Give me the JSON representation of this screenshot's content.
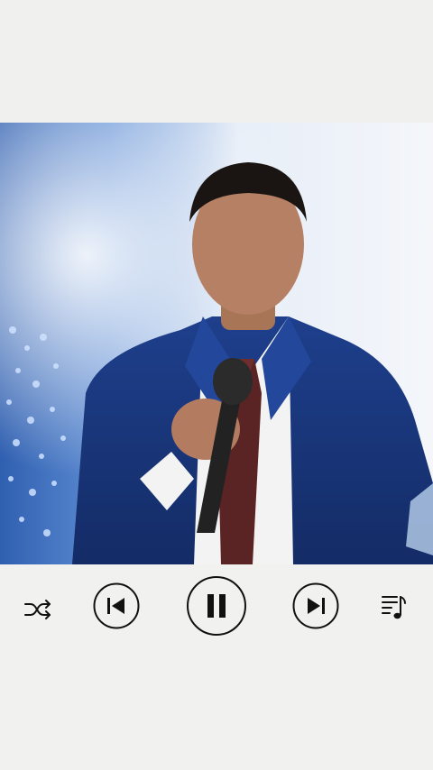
{
  "player": {
    "video": {
      "description_icon": "video-frame",
      "accent": "#1b3a8f"
    },
    "controls": {
      "shuffle": {
        "icon": "shuffle-icon"
      },
      "previous": {
        "icon": "skip-previous-icon"
      },
      "play_pause": {
        "icon": "pause-icon",
        "state": "playing"
      },
      "next": {
        "icon": "skip-next-icon"
      },
      "playlist": {
        "icon": "playlist-icon"
      }
    },
    "colors": {
      "background": "#f1f1f0",
      "icon": "#111111"
    }
  }
}
